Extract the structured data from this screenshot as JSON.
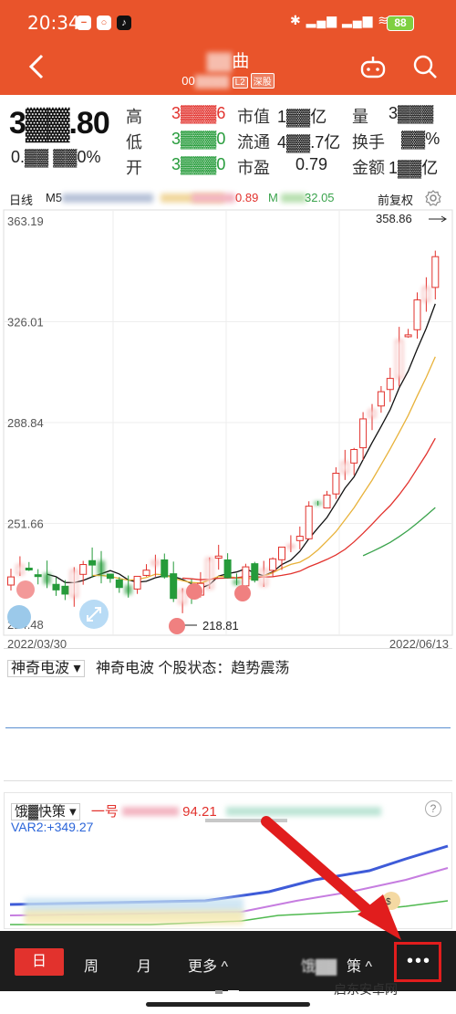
{
  "status_bar": {
    "time": "20:34",
    "battery": "88"
  },
  "header": {
    "title": "曲",
    "code": "00",
    "badge_l2": "L2",
    "badge_market": "深股"
  },
  "quote": {
    "price": "3▓▓.80",
    "change": "0.▓▓ ▓▓0%",
    "high_label": "高",
    "high_value": "3▓▓▓6",
    "low_label": "低",
    "low_value": "3▓▓▓0",
    "open_label": "开",
    "open_value": "3▓▓▓0",
    "mktcap_label": "市值",
    "mktcap_value": "1▓▓亿",
    "float_label": "流通",
    "float_value": "4▓▓.7亿",
    "pe_label": "市盈",
    "pe_value": "0.79",
    "vol_label": "量",
    "vol_value": "3▓▓▓",
    "turnover_label": "换手",
    "turnover_value": "▓▓%",
    "amount_label": "金额",
    "amount_value": "1▓▓亿"
  },
  "indicator_row": {
    "period": "日线",
    "ma5": "M5",
    "ma_val1": "0.89",
    "ma_label3": "M",
    "ma_val3": "32.05",
    "adjust": "前复权"
  },
  "chart_data": {
    "type": "candlestick",
    "y_tick_labels": [
      "363.19",
      "326.01",
      "288.84",
      "251.66",
      "214.48"
    ],
    "x_tick_labels": [
      "2022/03/30",
      "2022/06/13"
    ],
    "max_label": "358.86",
    "min_label": "218.81",
    "ylim": [
      214.48,
      363.19
    ],
    "grid": true,
    "up_color": "#e2322d",
    "down_color": "#259b3a"
  },
  "volume_panel": {
    "label1": "神奇电波",
    "label2": "神奇电波",
    "status": "个股状态：趋势震荡"
  },
  "strategy_panel": {
    "name": "饿▓快策",
    "text1": "一号",
    "val1": "94.21",
    "var2": "VAR2:+349.27",
    "help": "?"
  },
  "bottom_bar": {
    "day": "日",
    "week": "周",
    "month": "月",
    "more": "更多 ^",
    "strategy": "策 ^",
    "dots": "•••"
  },
  "watermark": "启东安卓网"
}
